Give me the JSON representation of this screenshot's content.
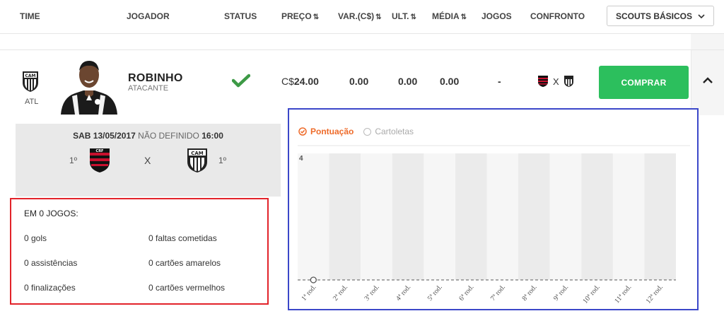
{
  "header": {
    "columns": [
      {
        "label": "TIME",
        "arrow": ""
      },
      {
        "label": "JOGADOR",
        "arrow": ""
      },
      {
        "label": "STATUS",
        "arrow": ""
      },
      {
        "label": "PREÇO",
        "arrow": "⇅"
      },
      {
        "label": "VAR.(C$)",
        "arrow": "⇅"
      },
      {
        "label": "ULT.",
        "arrow": "⇅"
      },
      {
        "label": "MÉDIA",
        "arrow": "⇅"
      },
      {
        "label": "JOGOS",
        "arrow": ""
      },
      {
        "label": "CONFRONTO",
        "arrow": ""
      }
    ],
    "scouts_button": "SCOUTS BÁSICOS"
  },
  "player": {
    "team_abbr": "ATL",
    "name": "ROBINHO",
    "position": "ATACANTE",
    "status_icon": "check-icon",
    "price_prefix": "C$",
    "price": "24.00",
    "variation": "0.00",
    "last": "0.00",
    "average": "0.00",
    "games": "-",
    "matchup_sep": "X",
    "buy_label": "COMPRAR"
  },
  "match": {
    "day": "SAB 13/05/2017",
    "venue": "NÃO DEFINIDO",
    "time": "16:00",
    "home_pos": "1º",
    "away_pos": "1º",
    "sep": "X"
  },
  "stats": {
    "title": "EM 0 JOGOS:",
    "items": [
      "0 gols",
      "0 faltas cometidas",
      "0 assistências",
      "0 cartões amarelos",
      "0 finalizações",
      "0 cartões vermelhos"
    ]
  },
  "chart_tabs": {
    "active": "Pontuação",
    "inactive": "Cartoletas"
  },
  "chart_data": {
    "type": "line",
    "categories": [
      "1ª rod.",
      "2ª rod.",
      "3ª rod.",
      "4ª rod.",
      "5ª rod.",
      "6ª rod.",
      "7ª rod.",
      "8ª rod.",
      "9ª rod.",
      "10ª rod.",
      "11ª rod.",
      "12ª rod."
    ],
    "series": [
      {
        "values": [
          0
        ]
      }
    ],
    "y_tick_labels": [
      "4"
    ],
    "ylim": [
      0,
      4
    ],
    "grid": false,
    "colors": {
      "band_light": "#f6f6f6",
      "band_dark": "#ebebeb",
      "line": "#555555"
    }
  },
  "colors": {
    "buy_green": "#2cbf5d",
    "active_orange": "#ee6b2a",
    "check_green": "#3d9a46",
    "flamengo_red": "#c8102e"
  }
}
